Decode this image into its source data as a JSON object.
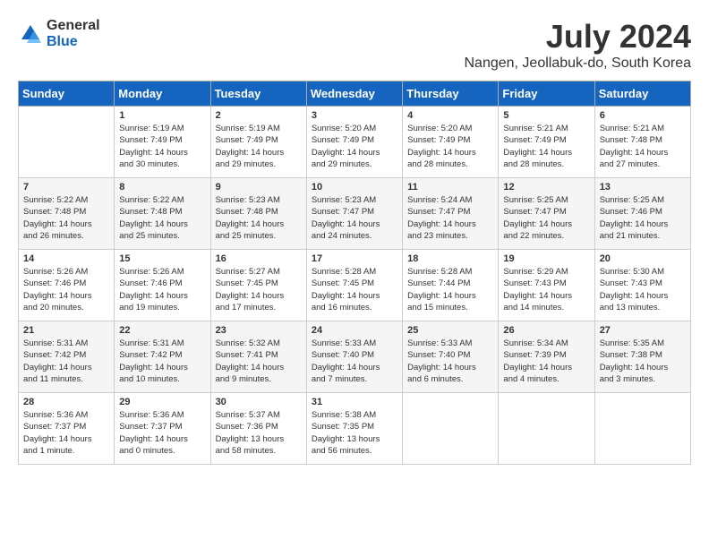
{
  "logo": {
    "general": "General",
    "blue": "Blue"
  },
  "title": "July 2024",
  "subtitle": "Nangen, Jeollabuk-do, South Korea",
  "headers": [
    "Sunday",
    "Monday",
    "Tuesday",
    "Wednesday",
    "Thursday",
    "Friday",
    "Saturday"
  ],
  "weeks": [
    [
      {
        "day": "",
        "info": ""
      },
      {
        "day": "1",
        "info": "Sunrise: 5:19 AM\nSunset: 7:49 PM\nDaylight: 14 hours\nand 30 minutes."
      },
      {
        "day": "2",
        "info": "Sunrise: 5:19 AM\nSunset: 7:49 PM\nDaylight: 14 hours\nand 29 minutes."
      },
      {
        "day": "3",
        "info": "Sunrise: 5:20 AM\nSunset: 7:49 PM\nDaylight: 14 hours\nand 29 minutes."
      },
      {
        "day": "4",
        "info": "Sunrise: 5:20 AM\nSunset: 7:49 PM\nDaylight: 14 hours\nand 28 minutes."
      },
      {
        "day": "5",
        "info": "Sunrise: 5:21 AM\nSunset: 7:49 PM\nDaylight: 14 hours\nand 28 minutes."
      },
      {
        "day": "6",
        "info": "Sunrise: 5:21 AM\nSunset: 7:48 PM\nDaylight: 14 hours\nand 27 minutes."
      }
    ],
    [
      {
        "day": "7",
        "info": "Sunrise: 5:22 AM\nSunset: 7:48 PM\nDaylight: 14 hours\nand 26 minutes."
      },
      {
        "day": "8",
        "info": "Sunrise: 5:22 AM\nSunset: 7:48 PM\nDaylight: 14 hours\nand 25 minutes."
      },
      {
        "day": "9",
        "info": "Sunrise: 5:23 AM\nSunset: 7:48 PM\nDaylight: 14 hours\nand 25 minutes."
      },
      {
        "day": "10",
        "info": "Sunrise: 5:23 AM\nSunset: 7:47 PM\nDaylight: 14 hours\nand 24 minutes."
      },
      {
        "day": "11",
        "info": "Sunrise: 5:24 AM\nSunset: 7:47 PM\nDaylight: 14 hours\nand 23 minutes."
      },
      {
        "day": "12",
        "info": "Sunrise: 5:25 AM\nSunset: 7:47 PM\nDaylight: 14 hours\nand 22 minutes."
      },
      {
        "day": "13",
        "info": "Sunrise: 5:25 AM\nSunset: 7:46 PM\nDaylight: 14 hours\nand 21 minutes."
      }
    ],
    [
      {
        "day": "14",
        "info": "Sunrise: 5:26 AM\nSunset: 7:46 PM\nDaylight: 14 hours\nand 20 minutes."
      },
      {
        "day": "15",
        "info": "Sunrise: 5:26 AM\nSunset: 7:46 PM\nDaylight: 14 hours\nand 19 minutes."
      },
      {
        "day": "16",
        "info": "Sunrise: 5:27 AM\nSunset: 7:45 PM\nDaylight: 14 hours\nand 17 minutes."
      },
      {
        "day": "17",
        "info": "Sunrise: 5:28 AM\nSunset: 7:45 PM\nDaylight: 14 hours\nand 16 minutes."
      },
      {
        "day": "18",
        "info": "Sunrise: 5:28 AM\nSunset: 7:44 PM\nDaylight: 14 hours\nand 15 minutes."
      },
      {
        "day": "19",
        "info": "Sunrise: 5:29 AM\nSunset: 7:43 PM\nDaylight: 14 hours\nand 14 minutes."
      },
      {
        "day": "20",
        "info": "Sunrise: 5:30 AM\nSunset: 7:43 PM\nDaylight: 14 hours\nand 13 minutes."
      }
    ],
    [
      {
        "day": "21",
        "info": "Sunrise: 5:31 AM\nSunset: 7:42 PM\nDaylight: 14 hours\nand 11 minutes."
      },
      {
        "day": "22",
        "info": "Sunrise: 5:31 AM\nSunset: 7:42 PM\nDaylight: 14 hours\nand 10 minutes."
      },
      {
        "day": "23",
        "info": "Sunrise: 5:32 AM\nSunset: 7:41 PM\nDaylight: 14 hours\nand 9 minutes."
      },
      {
        "day": "24",
        "info": "Sunrise: 5:33 AM\nSunset: 7:40 PM\nDaylight: 14 hours\nand 7 minutes."
      },
      {
        "day": "25",
        "info": "Sunrise: 5:33 AM\nSunset: 7:40 PM\nDaylight: 14 hours\nand 6 minutes."
      },
      {
        "day": "26",
        "info": "Sunrise: 5:34 AM\nSunset: 7:39 PM\nDaylight: 14 hours\nand 4 minutes."
      },
      {
        "day": "27",
        "info": "Sunrise: 5:35 AM\nSunset: 7:38 PM\nDaylight: 14 hours\nand 3 minutes."
      }
    ],
    [
      {
        "day": "28",
        "info": "Sunrise: 5:36 AM\nSunset: 7:37 PM\nDaylight: 14 hours\nand 1 minute."
      },
      {
        "day": "29",
        "info": "Sunrise: 5:36 AM\nSunset: 7:37 PM\nDaylight: 14 hours\nand 0 minutes."
      },
      {
        "day": "30",
        "info": "Sunrise: 5:37 AM\nSunset: 7:36 PM\nDaylight: 13 hours\nand 58 minutes."
      },
      {
        "day": "31",
        "info": "Sunrise: 5:38 AM\nSunset: 7:35 PM\nDaylight: 13 hours\nand 56 minutes."
      },
      {
        "day": "",
        "info": ""
      },
      {
        "day": "",
        "info": ""
      },
      {
        "day": "",
        "info": ""
      }
    ]
  ]
}
